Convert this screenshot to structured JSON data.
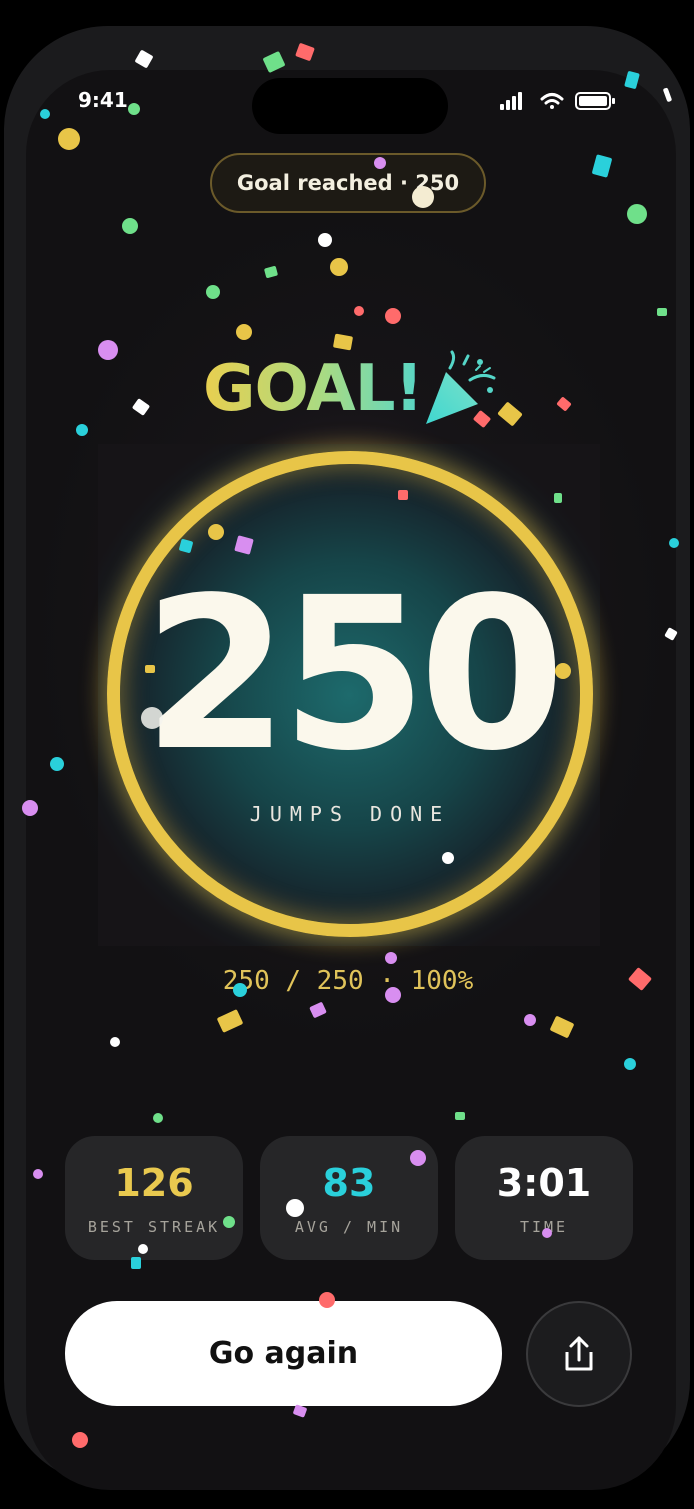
{
  "status_bar": {
    "time": "9:41",
    "icons": [
      "signal-icon",
      "wifi-icon",
      "battery-icon"
    ]
  },
  "goal_pill": {
    "label": "Goal reached · 250"
  },
  "celebration": {
    "title": "GOAL!",
    "icon": "party-popper-icon"
  },
  "counter": {
    "value": "250",
    "label": "JUMPS DONE",
    "progress_fraction": 1.0
  },
  "progress_text": "250 / 250 · 100%",
  "stats": [
    {
      "value": "126",
      "label": "BEST STREAK",
      "color": "#e9c94f"
    },
    {
      "value": "83",
      "label": "AVG / MIN",
      "color": "#2ad0db"
    },
    {
      "value": "3:01",
      "label": "TIME",
      "color": "#ffffff"
    }
  ],
  "actions": {
    "primary_label": "Go again",
    "share_icon": "share-icon"
  },
  "colors": {
    "accent_yellow": "#e8c548",
    "accent_teal": "#2ad0db",
    "background": "#121113"
  }
}
